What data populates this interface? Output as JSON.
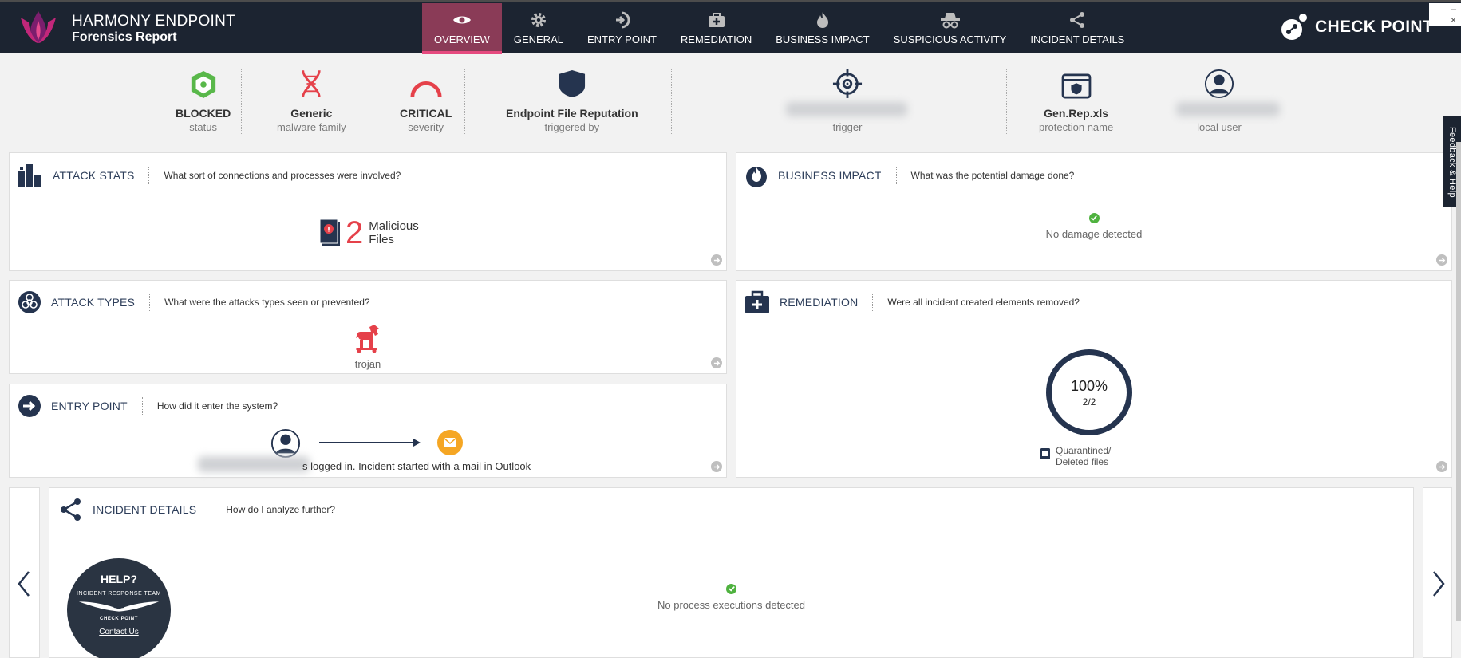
{
  "header": {
    "app_title": "HARMONY ENDPOINT",
    "app_subtitle": "Forensics Report",
    "brand": "CHECK POINT",
    "tabs": [
      {
        "label": "OVERVIEW",
        "icon": "eye-icon",
        "active": true
      },
      {
        "label": "GENERAL",
        "icon": "gear-icon",
        "active": false
      },
      {
        "label": "ENTRY POINT",
        "icon": "entry-arrow-icon",
        "active": false
      },
      {
        "label": "REMEDIATION",
        "icon": "medkit-icon",
        "active": false
      },
      {
        "label": "BUSINESS IMPACT",
        "icon": "flame-icon",
        "active": false
      },
      {
        "label": "SUSPICIOUS ACTIVITY",
        "icon": "spy-icon",
        "active": false
      },
      {
        "label": "INCIDENT DETAILS",
        "icon": "share-icon",
        "active": false
      }
    ]
  },
  "summary": {
    "status": {
      "value": "BLOCKED",
      "label": "status"
    },
    "malware": {
      "value": "Generic",
      "label": "malware family"
    },
    "severity": {
      "value": "CRITICAL",
      "label": "severity"
    },
    "triggered": {
      "value": "Endpoint File Reputation",
      "label": "triggered by"
    },
    "trigger": {
      "label": "trigger"
    },
    "protection": {
      "value": "Gen.Rep.xls",
      "label": "protection name"
    },
    "user": {
      "label": "local user"
    }
  },
  "cards": {
    "attack_stats": {
      "title": "ATTACK STATS",
      "question": "What sort of connections and processes were involved?",
      "count": "2",
      "count_label_1": "Malicious",
      "count_label_2": "Files"
    },
    "business_impact": {
      "title": "BUSINESS IMPACT",
      "question": "What was the potential damage done?",
      "result": "No damage detected"
    },
    "attack_types": {
      "title": "ATTACK TYPES",
      "question": "What were the attacks types seen or prevented?",
      "type": "trojan"
    },
    "remediation": {
      "title": "REMEDIATION",
      "question": "Were all incident created elements removed?",
      "progress": 1.0,
      "percent": "100%",
      "fraction": "2/2",
      "legend_1": "Quarantined/",
      "legend_2": "Deleted files"
    },
    "entry_point": {
      "title": "ENTRY POINT",
      "question": "How did it enter the system?",
      "text": "s logged in. Incident started with a mail in Outlook"
    },
    "incident_details": {
      "title": "INCIDENT DETAILS",
      "question": "How do I analyze further?",
      "result": "No process executions detected"
    }
  },
  "help": {
    "title": "HELP?",
    "team": "INCIDENT RESPONSE TEAM",
    "org": "CHECK POINT",
    "link": "Contact Us"
  },
  "feedback": "Feedback & Help",
  "window": {
    "close": "×",
    "min": "–"
  },
  "colors": {
    "topbar": "#1c2431",
    "active_tab": "#8a3b57",
    "accent_pink": "#e64a7f",
    "danger_red": "#e5414a",
    "success_green": "#4fb23f",
    "navy": "#25344f"
  }
}
